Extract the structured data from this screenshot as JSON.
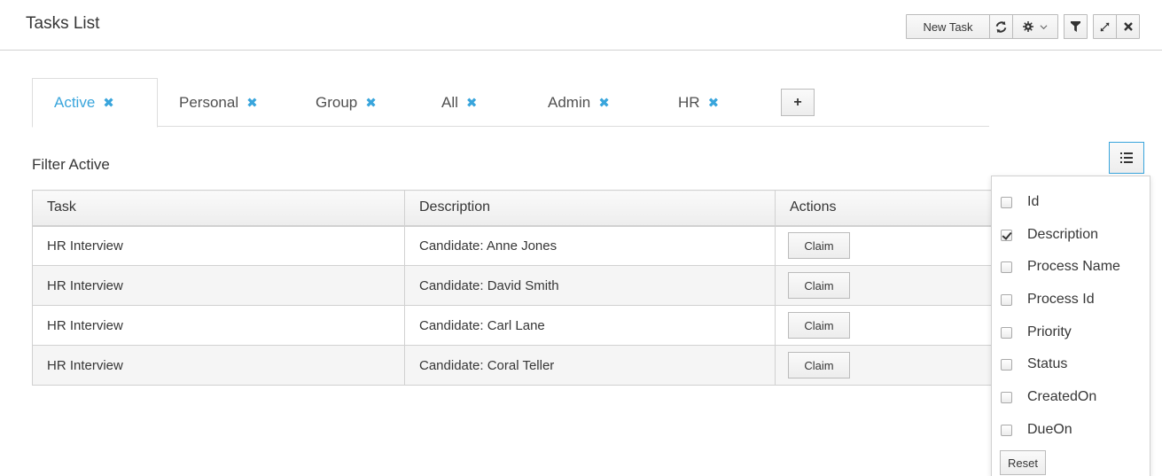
{
  "header": {
    "title": "Tasks List"
  },
  "toolbar": {
    "new_task_label": "New Task",
    "icons": [
      "refresh-icon",
      "gear-icon",
      "chevron-down-icon",
      "filter-icon",
      "expand-icon",
      "close-icon"
    ]
  },
  "tabs": [
    {
      "label": "Active",
      "active": true
    },
    {
      "label": "Personal",
      "active": false
    },
    {
      "label": "Group",
      "active": false
    },
    {
      "label": "All",
      "active": false
    },
    {
      "label": "Admin",
      "active": false
    },
    {
      "label": "HR",
      "active": false
    }
  ],
  "tab_close_glyph": "✖",
  "add_tab_glyph": "+",
  "filter": {
    "title": "Filter Active"
  },
  "table": {
    "columns": [
      "Task",
      "Description",
      "Actions"
    ],
    "rows": [
      {
        "task": "HR Interview",
        "description": "Candidate: Anne Jones",
        "action": "Claim"
      },
      {
        "task": "HR Interview",
        "description": "Candidate: David Smith",
        "action": "Claim"
      },
      {
        "task": "HR Interview",
        "description": "Candidate: Carl Lane",
        "action": "Claim"
      },
      {
        "task": "HR Interview",
        "description": "Candidate: Coral Teller",
        "action": "Claim"
      }
    ]
  },
  "column_picker": {
    "items": [
      {
        "label": "Id",
        "checked": false
      },
      {
        "label": "Description",
        "checked": true
      },
      {
        "label": "Process Name",
        "checked": false
      },
      {
        "label": "Process Id",
        "checked": false
      },
      {
        "label": "Priority",
        "checked": false
      },
      {
        "label": "Status",
        "checked": false
      },
      {
        "label": "CreatedOn",
        "checked": false
      },
      {
        "label": "DueOn",
        "checked": false
      }
    ],
    "reset_label": "Reset"
  },
  "colors": {
    "accent": "#39a5dc",
    "border": "#d1d1d1",
    "row_alt": "#f5f5f5"
  }
}
